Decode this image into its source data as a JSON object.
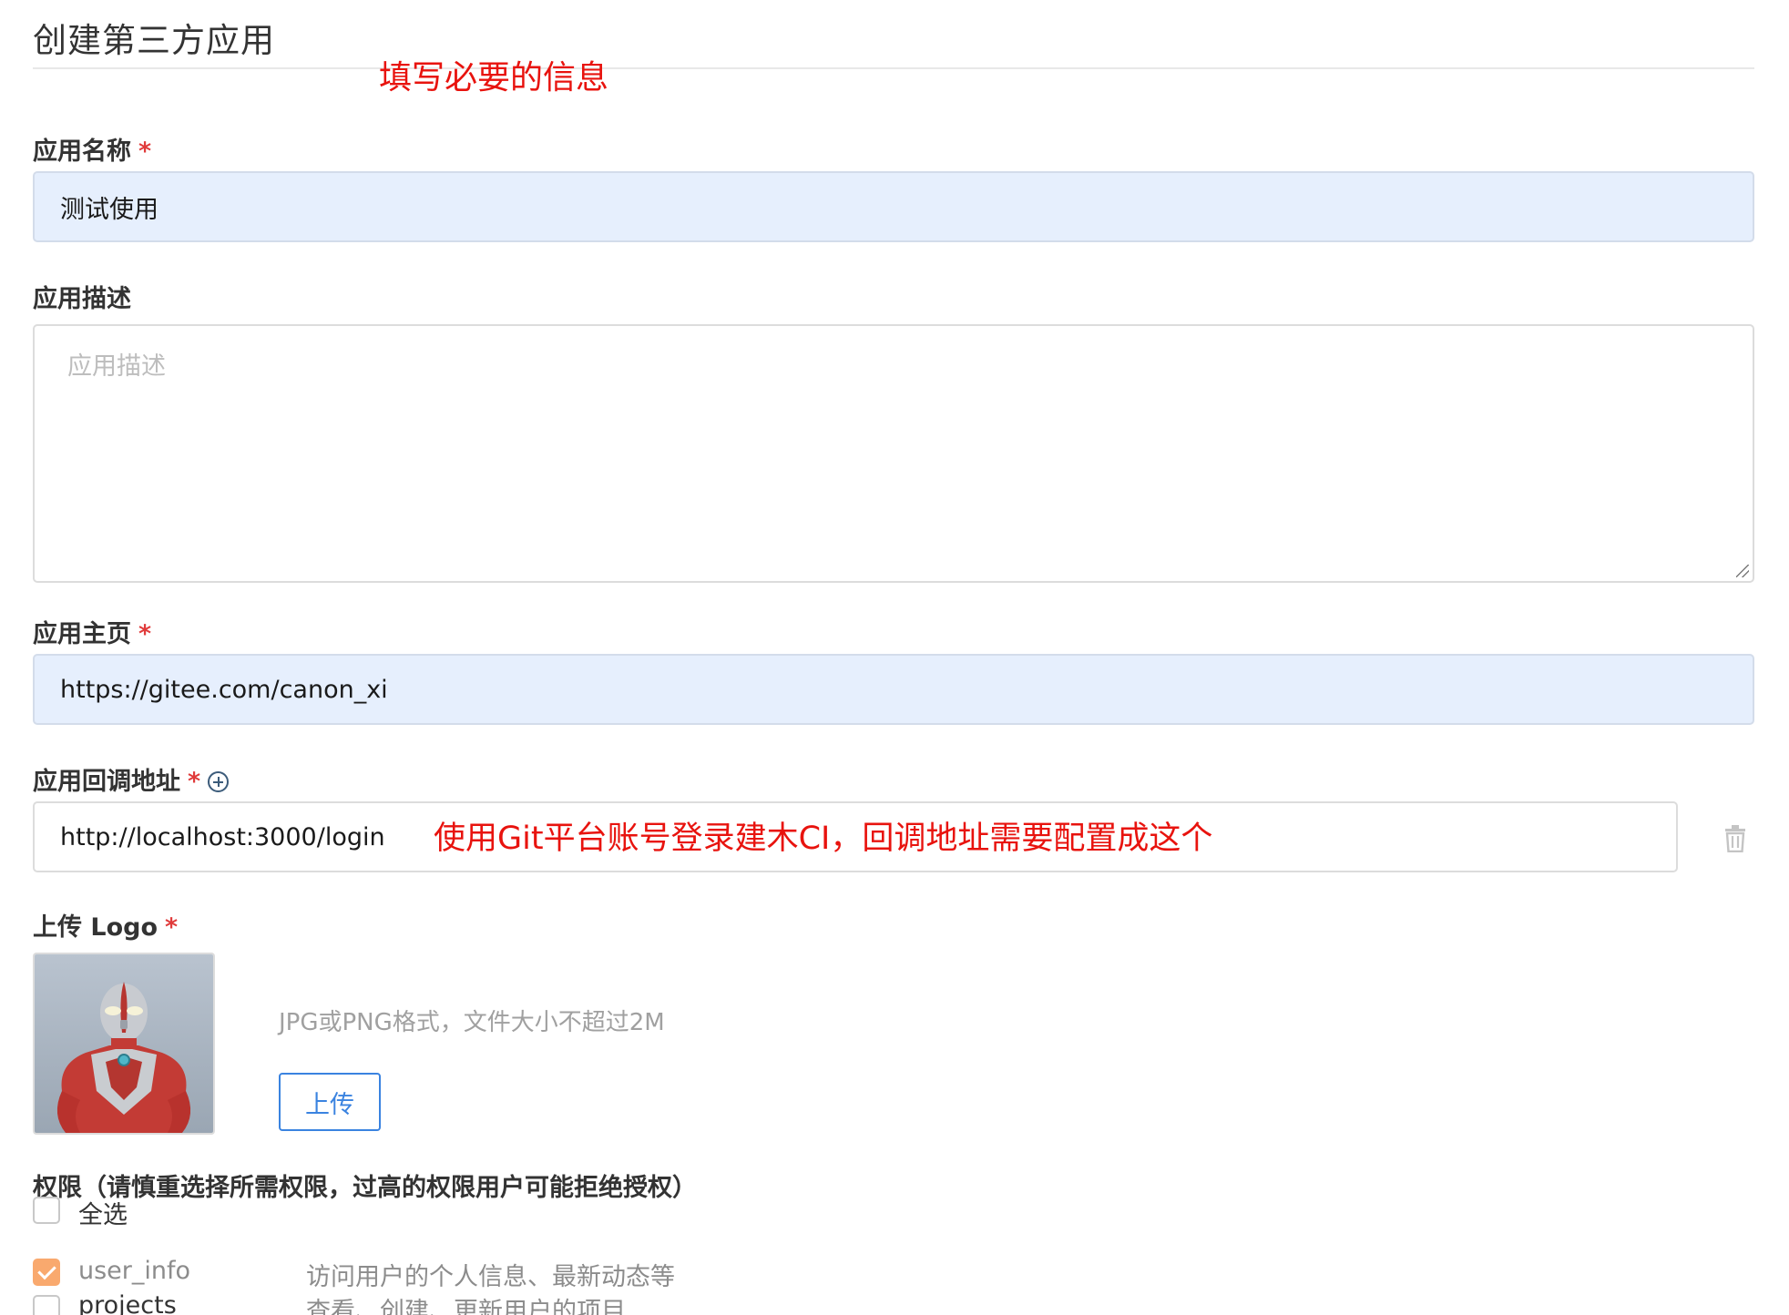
{
  "page": {
    "title": "创建第三方应用",
    "annotation_top": "填写必要的信息"
  },
  "form": {
    "app_name": {
      "label": "应用名称",
      "required_mark": "*",
      "value": "测试使用"
    },
    "app_description": {
      "label": "应用描述",
      "placeholder": "应用描述",
      "value": ""
    },
    "app_homepage": {
      "label": "应用主页",
      "required_mark": "*",
      "value": "https://gitee.com/canon_xi"
    },
    "callback_url": {
      "label": "应用回调地址",
      "required_mark": "*",
      "add_icon": "plus-circle-icon",
      "value": "http://localhost:3000/login",
      "delete_icon": "trash-icon",
      "annotation": "使用Git平台账号登录建木CI，回调地址需要配置成这个"
    },
    "logo": {
      "label": "上传 Logo",
      "required_mark": "*",
      "hint": "JPG或PNG格式，文件大小不超过2M",
      "upload_button": "上传"
    },
    "permissions": {
      "title": "权限（请慎重选择所需权限，过高的权限用户可能拒绝授权）",
      "select_all": {
        "label": "全选",
        "checked": false
      },
      "items": [
        {
          "name": "user_info",
          "description": "访问用户的个人信息、最新动态等",
          "checked": true
        },
        {
          "name": "projects",
          "description": "查看、创建、更新用户的项目",
          "checked": false
        }
      ]
    }
  },
  "colors": {
    "annotation": "#e8130e",
    "required": "#e03b3b",
    "filled_input_bg": "#e6effd",
    "primary": "#3a83e0",
    "checkbox_checked": "#f9a96e"
  }
}
